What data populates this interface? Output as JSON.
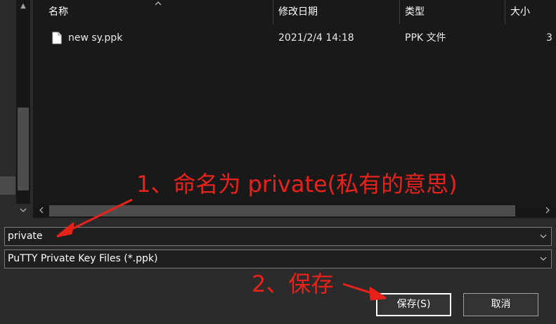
{
  "file_list": {
    "columns": [
      {
        "key": "name",
        "label": "名称"
      },
      {
        "key": "modified",
        "label": "修改日期"
      },
      {
        "key": "type",
        "label": "类型"
      },
      {
        "key": "size",
        "label": "大小"
      }
    ],
    "rows": [
      {
        "name": "new sy.ppk",
        "modified": "2021/2/4 14:18",
        "type": "PPK 文件",
        "size": "3"
      }
    ],
    "icon": "document-icon"
  },
  "filename_field": {
    "value": "private"
  },
  "filetype_select": {
    "selected": "PuTTY Private Key Files (*.ppk)"
  },
  "buttons": {
    "save_label": "保存(S)",
    "cancel_label": "取消"
  },
  "annotations": {
    "step1": "1、命名为 private(私有的意思)",
    "step2": "2、保存",
    "color": "#e8221b"
  },
  "colors": {
    "background": "#2b2b2b",
    "list_background": "#191919",
    "text": "#ffffff"
  }
}
